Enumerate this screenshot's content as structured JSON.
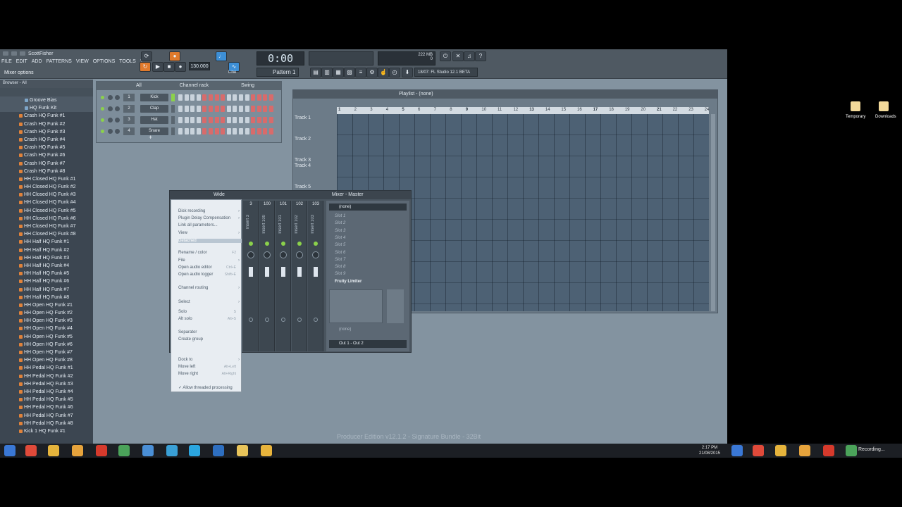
{
  "app": {
    "window_title": "ScottFisher",
    "menu": [
      "FILE",
      "EDIT",
      "ADD",
      "PATTERNS",
      "VIEW",
      "OPTIONS",
      "TOOLS",
      "?"
    ],
    "hint": "Mixer options",
    "tempo": "130.000",
    "time": "0:00",
    "pattern": "Pattern 1",
    "news": "18/07: FL Studio 12.1 BETA",
    "mode": "Line",
    "cpu": "222 MB",
    "cpu2": "0"
  },
  "browser": {
    "title": "Browser - All",
    "items": [
      {
        "label": "Groove Bias",
        "folder": true
      },
      {
        "label": "HQ Funk Kit",
        "folder": true
      },
      {
        "label": "Crash HQ Funk #1"
      },
      {
        "label": "Crash HQ Funk #2"
      },
      {
        "label": "Crash HQ Funk #3"
      },
      {
        "label": "Crash HQ Funk #4"
      },
      {
        "label": "Crash HQ Funk #5"
      },
      {
        "label": "Crash HQ Funk #6"
      },
      {
        "label": "Crash HQ Funk #7"
      },
      {
        "label": "Crash HQ Funk #8"
      },
      {
        "label": "HH Closed HQ Funk #1"
      },
      {
        "label": "HH Closed HQ Funk #2"
      },
      {
        "label": "HH Closed HQ Funk #3"
      },
      {
        "label": "HH Closed HQ Funk #4"
      },
      {
        "label": "HH Closed HQ Funk #5"
      },
      {
        "label": "HH Closed HQ Funk #6"
      },
      {
        "label": "HH Closed HQ Funk #7"
      },
      {
        "label": "HH Closed HQ Funk #8"
      },
      {
        "label": "HH Half HQ Funk #1"
      },
      {
        "label": "HH Half HQ Funk #2"
      },
      {
        "label": "HH Half HQ Funk #3"
      },
      {
        "label": "HH Half HQ Funk #4"
      },
      {
        "label": "HH Half HQ Funk #5"
      },
      {
        "label": "HH Half HQ Funk #6"
      },
      {
        "label": "HH Half HQ Funk #7"
      },
      {
        "label": "HH Half HQ Funk #8"
      },
      {
        "label": "HH Open HQ Funk #1"
      },
      {
        "label": "HH Open HQ Funk #2"
      },
      {
        "label": "HH Open HQ Funk #3"
      },
      {
        "label": "HH Open HQ Funk #4"
      },
      {
        "label": "HH Open HQ Funk #5"
      },
      {
        "label": "HH Open HQ Funk #6"
      },
      {
        "label": "HH Open HQ Funk #7"
      },
      {
        "label": "HH Open HQ Funk #8"
      },
      {
        "label": "HH Pedal HQ Funk #1"
      },
      {
        "label": "HH Pedal HQ Funk #2"
      },
      {
        "label": "HH Pedal HQ Funk #3"
      },
      {
        "label": "HH Pedal HQ Funk #4"
      },
      {
        "label": "HH Pedal HQ Funk #5"
      },
      {
        "label": "HH Pedal HQ Funk #6"
      },
      {
        "label": "HH Pedal HQ Funk #7"
      },
      {
        "label": "HH Pedal HQ Funk #8"
      },
      {
        "label": "Kick 1 HQ Funk #1"
      }
    ]
  },
  "rack": {
    "title": "Channel rack",
    "filter": "All",
    "swing": "Swing",
    "channels": [
      {
        "num": "1",
        "name": "Kick"
      },
      {
        "num": "2",
        "name": "Clap"
      },
      {
        "num": "3",
        "name": "Hat"
      },
      {
        "num": "4",
        "name": "Snare"
      }
    ],
    "add": "+"
  },
  "playlist": {
    "title": "Playlist - (none)",
    "bars": [
      "1",
      "2",
      "3",
      "4",
      "5",
      "6",
      "7",
      "8",
      "9",
      "10",
      "11",
      "12",
      "13",
      "14",
      "15",
      "16",
      "17",
      "18",
      "19",
      "20",
      "21",
      "22",
      "23",
      "24"
    ],
    "tracks": [
      "Track 1",
      "Track 2",
      "Track 3",
      "Track 4",
      "Track 5"
    ]
  },
  "mixer": {
    "title": "Mixer - Master",
    "preset": "Wide",
    "insert_labels": [
      "Insert 3",
      "Insert 100",
      "Insert 101",
      "Insert 102",
      "Insert 103"
    ],
    "insert_numbers": [
      "3",
      "100",
      "101",
      "102",
      "103"
    ],
    "none": "(none)",
    "slots": [
      "Slot 1",
      "Slot 2",
      "Slot 3",
      "Slot 4",
      "Slot 5",
      "Slot 6",
      "Slot 7",
      "Slot 8",
      "Slot 9"
    ],
    "limiter": "Fruity Limiter",
    "none2": "(none)",
    "output": "Out 1 - Out 2"
  },
  "menu": {
    "items": [
      {
        "label": "Disk recording",
        "arrow": true
      },
      {
        "label": "Plugin Delay Compensation",
        "arrow": true
      },
      {
        "label": "Link all parameters...",
        "arrow": false
      },
      {
        "label": "View",
        "arrow": true
      },
      {
        "label": "Detached",
        "arrow": false
      },
      {
        "label": "Rename / color",
        "shortcut": "F2"
      },
      {
        "label": "File",
        "arrow": true
      },
      {
        "label": "Open audio editor",
        "shortcut": "Ctrl+E"
      },
      {
        "label": "Open audio logger",
        "shortcut": "Shift+E"
      },
      {
        "label": "Channel routing",
        "arrow": true
      },
      {
        "label": "Select",
        "arrow": true
      },
      {
        "label": "Solo",
        "shortcut": "S"
      },
      {
        "label": "Alt solo",
        "shortcut": "Alt+S"
      },
      {
        "label": "Separator"
      },
      {
        "label": "Create group"
      },
      {
        "label": "Dock to",
        "arrow": true
      },
      {
        "label": "Move left",
        "shortcut": "Alt+Left"
      },
      {
        "label": "Move right",
        "shortcut": "Alt+Right"
      },
      {
        "label": "✓ Allow threaded processing"
      }
    ]
  },
  "watermark": "Producer Edition v12.1.2 - Signature Bundle - 32Bit",
  "desktop": {
    "icons": [
      "Temporary",
      "Downloads"
    ]
  },
  "taskbar": {
    "time": "2:17 PM",
    "date": "21/08/2015",
    "recording": "Recording..."
  },
  "colors": {
    "accent": "#e07a2c",
    "highlight": "#3d8fd6",
    "step_on": "#d86b6b",
    "step_off": "#c9d3dc",
    "led": "#8bd14b"
  }
}
